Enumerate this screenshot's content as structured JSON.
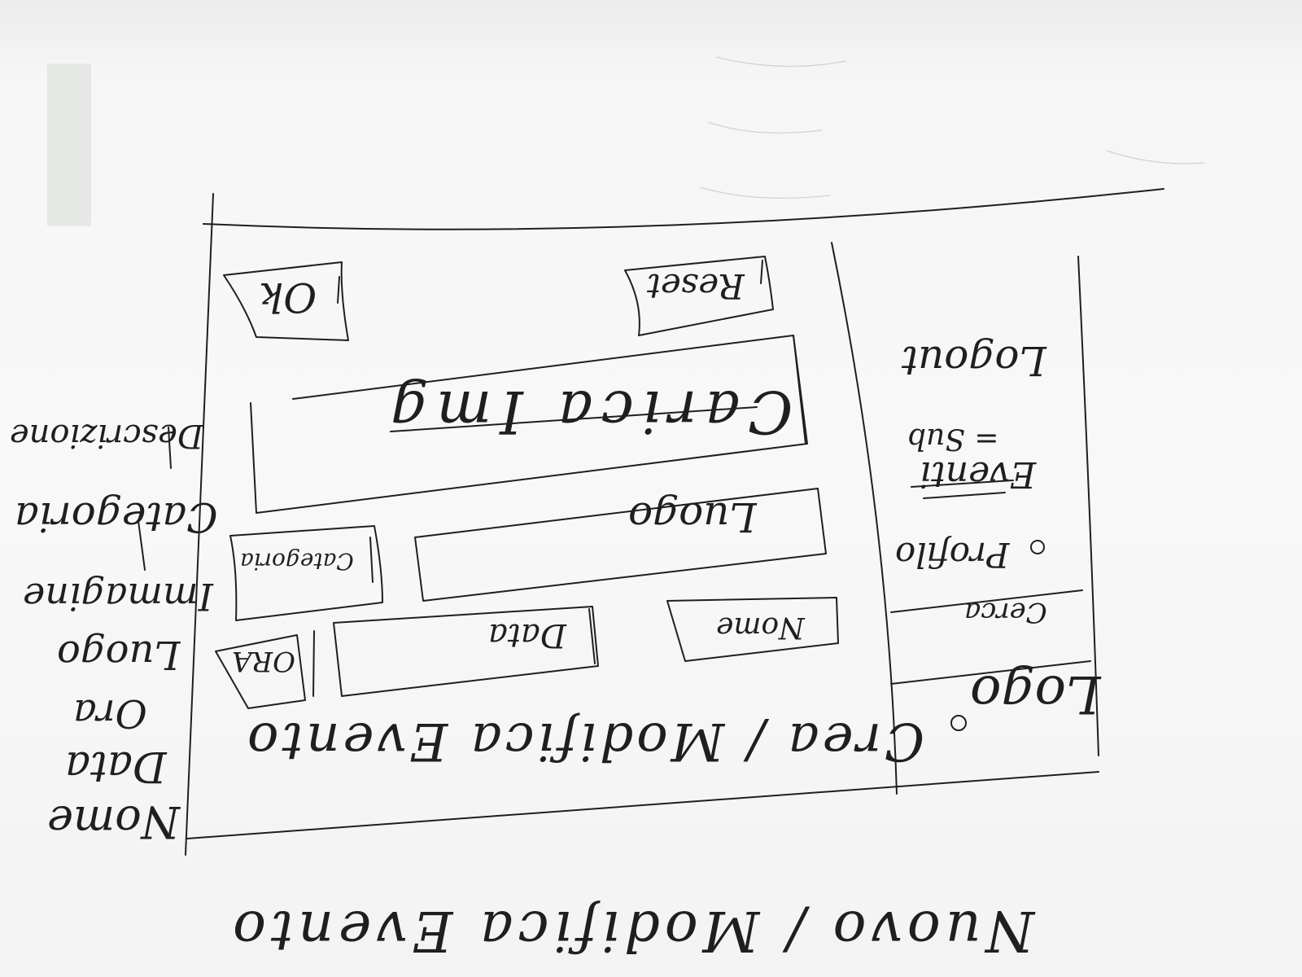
{
  "page_title": "Nuovo / Modifica Evento",
  "form": {
    "title": "Crea / Modifica Evento",
    "ok_label": "Ok",
    "reset_label": "Reset",
    "file_upload_label": "Carica Img",
    "place_label": "Luogo",
    "category_label": "Categoria",
    "date_label": "Data",
    "time_label": "ORA",
    "name_label": "Nome"
  },
  "sidebar": {
    "logo_label": "Logo",
    "search_label": "Cerca",
    "profile_label": "Profilo",
    "events_label": "Eventi",
    "events_sub": "= Sub",
    "logout_label": "Logout"
  },
  "field_list": {
    "items": [
      "Nome",
      "Data",
      "Ora",
      "Luogo",
      "Immagine",
      "Categoria",
      "Descrizione"
    ]
  }
}
